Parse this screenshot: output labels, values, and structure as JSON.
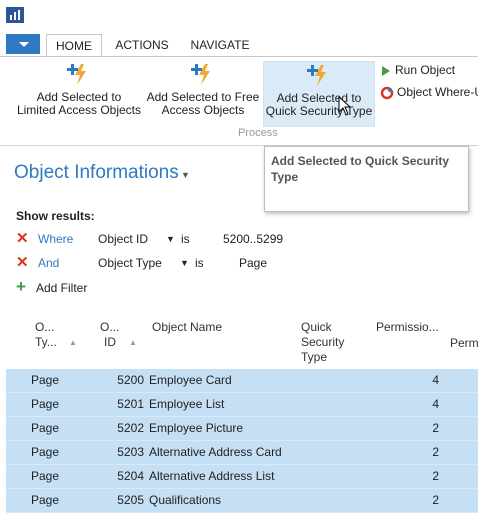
{
  "ribbon_tabs": [
    "HOME",
    "ACTIONS",
    "NAVIGATE"
  ],
  "ribbon": {
    "buttons": [
      {
        "line1": "Add Selected to",
        "line2": "Limited Access Objects"
      },
      {
        "line1": "Add Selected to Free",
        "line2": "Access Objects"
      },
      {
        "line1": "Add Selected to",
        "line2": "Quick Security Type"
      }
    ],
    "group_label": "Process",
    "small_buttons": [
      "Run Object",
      "Object Where-U"
    ]
  },
  "tooltip": "Add Selected to Quick Security Type",
  "page": {
    "title": "Object Informations",
    "show_results": "Show results:",
    "filters": [
      {
        "keyword": "Where",
        "field": "Object ID",
        "operator": "is",
        "value": "5200..5299"
      },
      {
        "keyword": "And",
        "field": "Object Type",
        "operator": "is",
        "value": "Page"
      }
    ],
    "add_filter": "Add Filter"
  },
  "table": {
    "headers": {
      "object_type": [
        "O...",
        "Ty..."
      ],
      "object_id": [
        "O...",
        "ID"
      ],
      "object_name": "Object Name",
      "quick_security_type": [
        "Quick",
        "Security",
        "Type"
      ],
      "permissions": "Permissio...",
      "perm_cut": "Perm"
    },
    "rows": [
      {
        "type": "Page",
        "id": "5200",
        "name": "Employee Card",
        "perm": "4"
      },
      {
        "type": "Page",
        "id": "5201",
        "name": "Employee List",
        "perm": "4"
      },
      {
        "type": "Page",
        "id": "5202",
        "name": "Employee Picture",
        "perm": "2"
      },
      {
        "type": "Page",
        "id": "5203",
        "name": "Alternative Address Card",
        "perm": "2"
      },
      {
        "type": "Page",
        "id": "5204",
        "name": "Alternative Address List",
        "perm": "2"
      },
      {
        "type": "Page",
        "id": "5205",
        "name": "Qualifications",
        "perm": "2"
      }
    ]
  },
  "colors": {
    "accent": "#2f78c4",
    "selection": "#c5dff5",
    "remove": "#d9351e",
    "add": "#3f9a3f"
  }
}
